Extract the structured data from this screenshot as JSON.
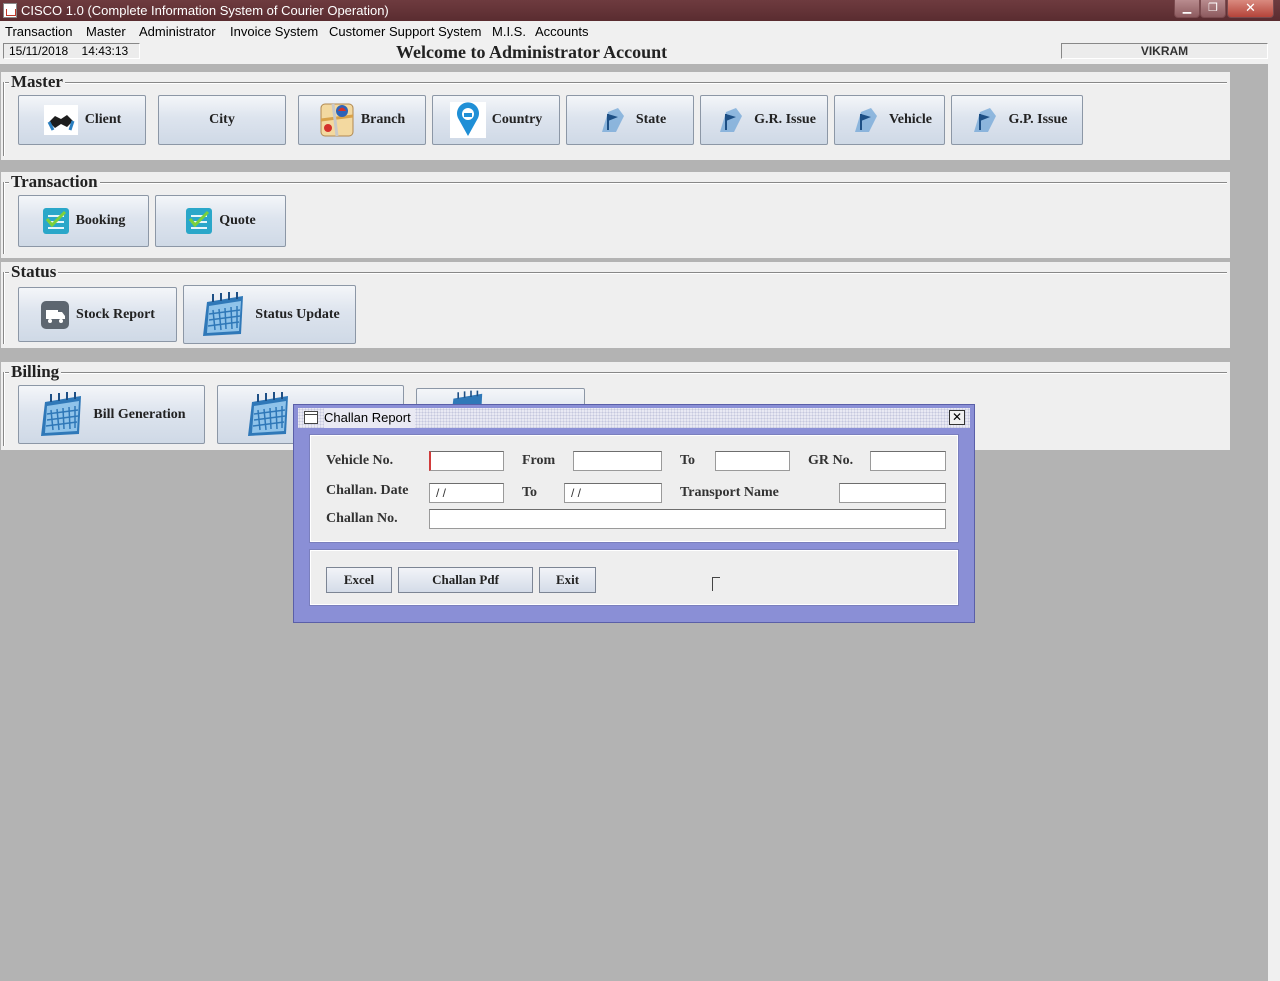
{
  "window": {
    "title": "CISCO 1.0 (Complete Information System of Courier Operation)",
    "minimize": "▁",
    "maximize": "❐",
    "close": "✕"
  },
  "menu": [
    "Transaction",
    "Master",
    "Administrator",
    "Invoice System",
    "Customer Support System",
    "M.I.S.",
    "Accounts"
  ],
  "status": {
    "date": "15/11/2018",
    "time": "14:43:13",
    "welcome": "Welcome to Administrator Account",
    "user": "VIKRAM"
  },
  "sections": {
    "master": {
      "title": "Master",
      "buttons": [
        {
          "label": "Client",
          "icon": "handshake-icon"
        },
        {
          "label": "City",
          "icon": ""
        },
        {
          "label": "Branch",
          "icon": "map-icon"
        },
        {
          "label": "Country",
          "icon": "location-pin-icon"
        },
        {
          "label": "State",
          "icon": "map-flag-icon"
        },
        {
          "label": "G.R. Issue",
          "icon": "map-flag-icon"
        },
        {
          "label": "Vehicle",
          "icon": "map-flag-icon"
        },
        {
          "label": "G.P. Issue",
          "icon": "map-flag-icon"
        }
      ]
    },
    "transaction": {
      "title": "Transaction",
      "buttons": [
        {
          "label": "Booking",
          "icon": "checklist-icon"
        },
        {
          "label": "Quote",
          "icon": "checklist-icon"
        }
      ]
    },
    "status": {
      "title": "Status",
      "buttons": [
        {
          "label": "Stock Report",
          "icon": "truck-icon"
        },
        {
          "label": "Status Update",
          "icon": "calendar-icon"
        }
      ]
    },
    "billing": {
      "title": "Billing",
      "buttons": [
        {
          "label": "Bill Generation",
          "icon": "calendar-icon"
        },
        {
          "label": "",
          "icon": "calendar-icon"
        },
        {
          "label": "",
          "icon": "calendar-icon"
        }
      ]
    }
  },
  "dialog": {
    "title": "Challan Report",
    "close": "✕",
    "labels": {
      "vehicle_no": "Vehicle No.",
      "from": "From",
      "to": "To",
      "gr_no": "GR No.",
      "challan_date": "Challan. Date",
      "date_to": "To",
      "transport_name": "Transport Name",
      "challan_no": "Challan No."
    },
    "fields": {
      "vehicle_no": "",
      "from": "",
      "to": "",
      "gr_no": "",
      "challan_date": "/ /",
      "date_to": "/ /",
      "transport_name": "",
      "challan_no": ""
    },
    "buttons": {
      "excel": "Excel",
      "challan_pdf": "Challan Pdf",
      "exit": "Exit"
    }
  },
  "colors": {
    "title_bar": "#5a2c30",
    "desktop": "#b3b3b3",
    "dialog_frame": "#8a8fd6",
    "panel": "#efefef"
  }
}
